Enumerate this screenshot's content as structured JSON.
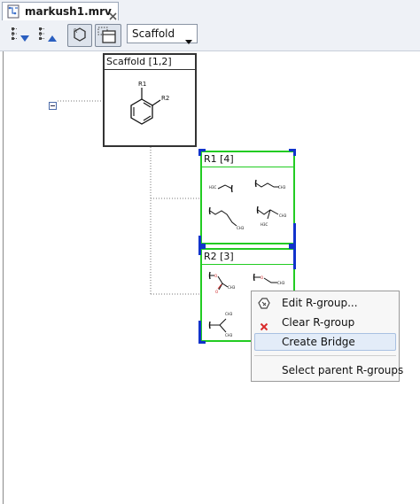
{
  "tab": {
    "title": "markush1.mrv"
  },
  "toolbar": {
    "view_select": {
      "value": "Scaffold"
    }
  },
  "scaffold": {
    "header": "Scaffold [1,2]",
    "atoms": {
      "r1": "R1",
      "r2": "R2"
    }
  },
  "rgroups": [
    {
      "header": "R1 [4]",
      "fragment_labels": [
        "H3C",
        "CH3",
        "CH3",
        "H3C",
        "CH3"
      ]
    },
    {
      "header": "R2 [3]",
      "fragment_labels": [
        "O",
        "O",
        "CH3",
        "O",
        "CH3",
        "CH3",
        "CH3"
      ]
    }
  ],
  "context_menu": {
    "items": [
      {
        "label": "Edit R-group...",
        "icon": "edit-rgroup-icon"
      },
      {
        "label": "Clear R-group",
        "icon": "clear-icon"
      },
      {
        "label": "Create Bridge",
        "icon": "",
        "highlighted": true
      },
      {
        "label": "Select parent R-groups",
        "icon": ""
      }
    ]
  },
  "colors": {
    "selection_green": "#22cc22",
    "corner_blue": "#1133cc",
    "clear_red": "#d92b2b",
    "oxygen_red": "#cc2222"
  }
}
